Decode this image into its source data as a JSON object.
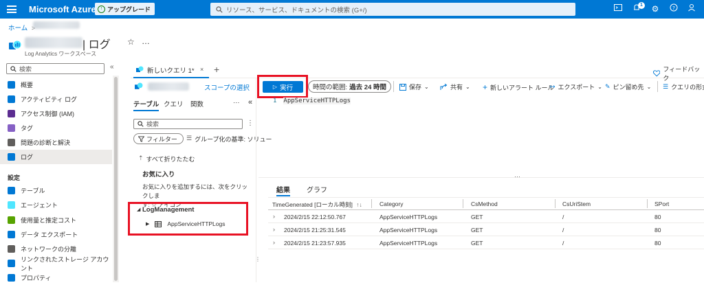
{
  "topbar": {
    "brand": "Microsoft Azure",
    "upgrade_label": "アップグレード",
    "search_placeholder": "リソース、サービス、ドキュメントの検索 (G+/)",
    "notification_count": "1"
  },
  "breadcrumb": {
    "home": "ホーム",
    "separator": ">"
  },
  "header": {
    "title": "| ログ",
    "subtitle": "Log Analytics ワークスペース",
    "favorite_icon": "☆",
    "more_icon": "…"
  },
  "sidebar": {
    "search_placeholder": "検索",
    "items": [
      {
        "label": "概要",
        "color": "#0078d4"
      },
      {
        "label": "アクティビティ ログ",
        "color": "#0078d4"
      },
      {
        "label": "アクセス制御 (IAM)",
        "color": "#5c2d91"
      },
      {
        "label": "タグ",
        "color": "#8661c5"
      },
      {
        "label": "問題の診断と解決",
        "color": "#605e5c"
      },
      {
        "label": "ログ",
        "color": "#0078d4"
      }
    ],
    "section_settings": "設定",
    "settings_items": [
      {
        "label": "テーブル",
        "color": "#0078d4"
      },
      {
        "label": "エージェント",
        "color": "#50e6ff"
      },
      {
        "label": "使用量と推定コスト",
        "color": "#57a300"
      },
      {
        "label": "データ エクスポート",
        "color": "#0078d4"
      },
      {
        "label": "ネットワークの分離",
        "color": "#605e5c"
      },
      {
        "label": "リンクされたストレージ アカウント",
        "color": "#0078d4"
      },
      {
        "label": "プロパティ",
        "color": "#0078d4"
      }
    ]
  },
  "query_tabs": {
    "tab_label": "新しいクエリ 1*",
    "close": "×",
    "add": "+",
    "feedback": "フィードバック"
  },
  "schema": {
    "scope_link": "スコープの選択",
    "tabs": [
      "テーブル",
      "クエリ",
      "関数"
    ],
    "more": "···",
    "collapse": "«",
    "search_placeholder": "検索",
    "filter_label": "フィルター",
    "groupby_label": "グループ化の基準: ソリュー",
    "collapse_all": "すべて折りたたむ",
    "favorites_title": "お気に入り",
    "favorites_hint_1": "お気に入りを追加するには、次をクリックしま",
    "favorites_hint_2": "す: ☆ アイコン",
    "group_name": "LogManagement",
    "table_name": "AppServiceHTTPLogs"
  },
  "toolbar": {
    "run": "実行",
    "time_range_label": "時間の範囲:",
    "time_range_value": "過去 24 時間",
    "save": "保存",
    "share": "共有",
    "new_alert": "新しいアラート ルール",
    "export": "エクスポート",
    "pin": "ピン留め先",
    "format": "クエリの形式"
  },
  "editor": {
    "line_no": "1",
    "query": "AppServiceHTTPLogs"
  },
  "results": {
    "tabs": [
      "結果",
      "グラフ"
    ],
    "columns": [
      "TimeGenerated [ローカル時刻]",
      "Category",
      "CsMethod",
      "CsUriStem",
      "SPort"
    ],
    "sort_indicator": "↑↓",
    "rows": [
      [
        "2024/2/15 22:12:50.767",
        "AppServiceHTTPLogs",
        "GET",
        "/",
        "80"
      ],
      [
        "2024/2/15 21:25:31.545",
        "AppServiceHTTPLogs",
        "GET",
        "/",
        "80"
      ],
      [
        "2024/2/15 21:23:57.935",
        "AppServiceHTTPLogs",
        "GET",
        "/",
        "80"
      ]
    ]
  }
}
